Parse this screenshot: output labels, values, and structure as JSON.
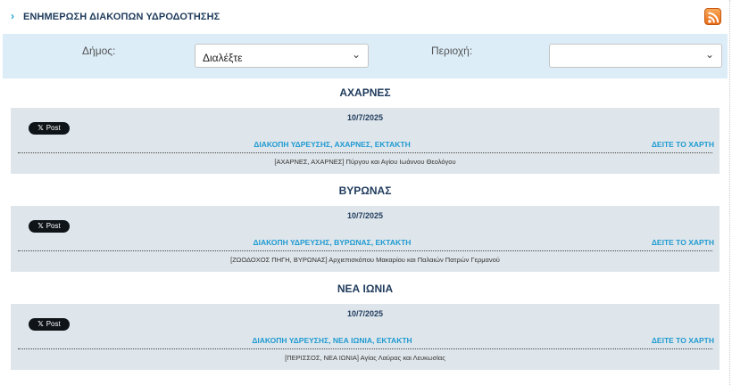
{
  "header": {
    "title": "ΕΝΗΜΕΡΩΣΗ ΔΙΑΚΟΠΩΝ ΥΔΡΟΔΟΤΗΣΗΣ",
    "chevron_icon": "chevron-right-icon",
    "rss_icon": "rss-icon"
  },
  "filters": {
    "municipality_label": "Δήμος:",
    "municipality_value": "Διαλέξτε",
    "area_label": "Περιοχή:",
    "area_value": ""
  },
  "regions": [
    {
      "name": "ΑΧΑΡΝΕΣ",
      "date": "10/7/2025",
      "post_label": "Post",
      "type": "ΔΙΑΚΟΠΗ ΥΔΡΕΥΣΗΣ, ΑΧΑΡΝΕΣ, ΕΚΤΑΚΤΗ",
      "map_link": "ΔΕΙΤΕ ΤΟ ΧΑΡΤΗ",
      "location": "[ΑΧΑΡΝΕΣ, ΑΧΑΡΝΕΣ] Πύργου και Αγίου Ιωάννου Θεολόγου"
    },
    {
      "name": "ΒΥΡΩΝΑΣ",
      "date": "10/7/2025",
      "post_label": "Post",
      "type": "ΔΙΑΚΟΠΗ ΥΔΡΕΥΣΗΣ, ΒΥΡΩΝΑΣ, ΕΚΤΑΚΤΗ",
      "map_link": "ΔΕΙΤΕ ΤΟ ΧΑΡΤΗ",
      "location": "[ΖΩΟΔΟΧΟΣ ΠΗΓΗ, ΒΥΡΩΝΑΣ] Αρχιεπισκόπου Μακαρίου και Παλαιών Πατρών Γερμανού"
    },
    {
      "name": "ΝΕΑ ΙΩΝΙΑ",
      "date": "10/7/2025",
      "post_label": "Post",
      "type": "ΔΙΑΚΟΠΗ ΥΔΡΕΥΣΗΣ, ΝΕΑ ΙΩΝΙΑ, ΕΚΤΑΚΤΗ",
      "map_link": "ΔΕΙΤΕ ΤΟ ΧΑΡΤΗ",
      "location": "[ΠΕΡΙΣΣΟΣ, ΝΕΑ ΙΩΝΙΑ] Αγίας Λαύρας και Λευκωσίας"
    }
  ],
  "colors": {
    "accent": "#1f9ad1",
    "heading": "#1f3b5c",
    "filter_bg": "#dcedf8",
    "card_bg": "#dfe6eb",
    "rss": "#e86b15"
  }
}
